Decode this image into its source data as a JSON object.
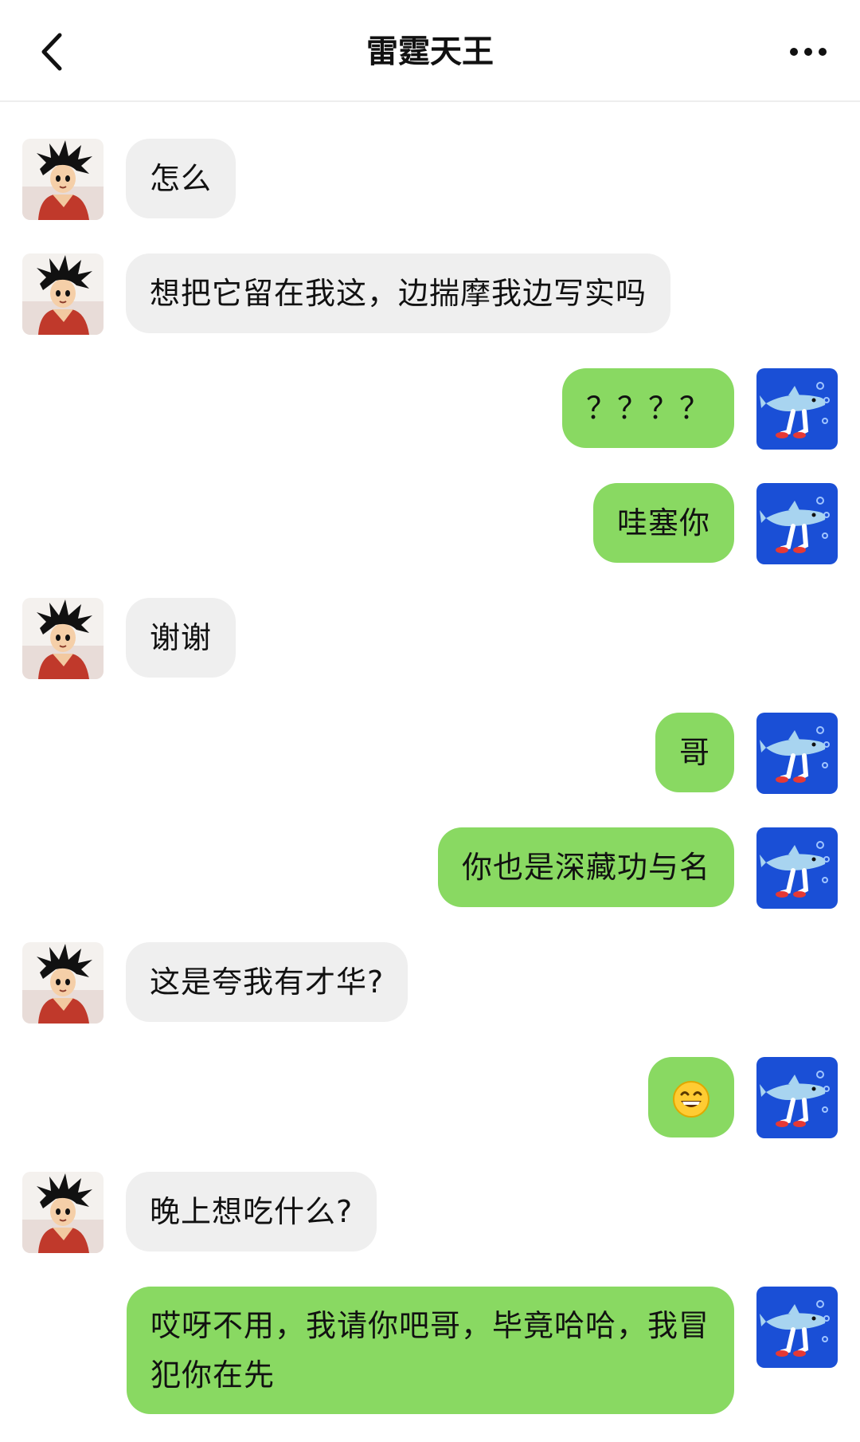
{
  "header": {
    "title": "雷霆天王",
    "back_icon": "chevron-left-icon",
    "more_icon": "more-dots-icon"
  },
  "contacts": {
    "other_avatar": "goku-avatar",
    "self_avatar": "shark-avatar"
  },
  "messages": [
    {
      "side": "left",
      "text": "怎么"
    },
    {
      "side": "left",
      "text": "想把它留在我这，边揣摩我边写实吗"
    },
    {
      "side": "right",
      "text": "？？？？"
    },
    {
      "side": "right",
      "text": "哇塞你"
    },
    {
      "side": "left",
      "text": "谢谢"
    },
    {
      "side": "right",
      "text": "哥"
    },
    {
      "side": "right",
      "text": "你也是深藏功与名"
    },
    {
      "side": "left",
      "text": "这是夸我有才华?"
    },
    {
      "side": "right",
      "emoji": "grinning-face-emoji"
    },
    {
      "side": "left",
      "text": "晚上想吃什么?"
    },
    {
      "side": "right",
      "text": "哎呀不用，我请你吧哥，毕竟哈哈，我冒犯你在先"
    }
  ],
  "colors": {
    "self_bubble": "#89d962",
    "other_bubble": "#efefef",
    "self_avatar_bg": "#1a4fd6"
  }
}
